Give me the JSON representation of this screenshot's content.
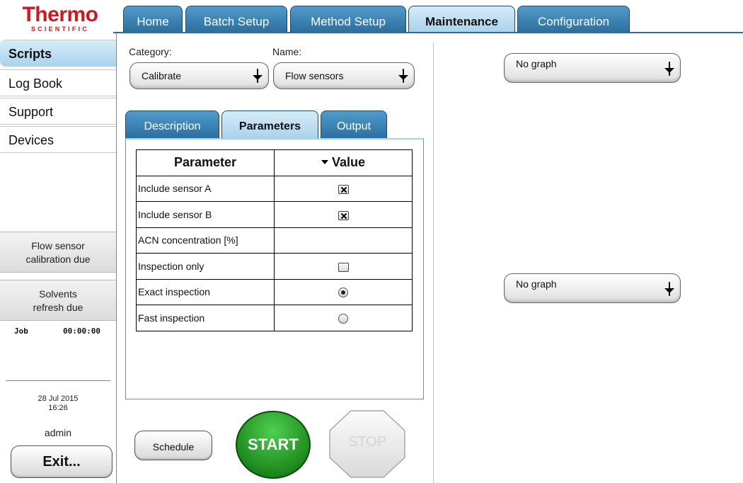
{
  "logo": {
    "main": "Thermo",
    "sub": "SCIENTIFIC"
  },
  "top_tabs": [
    {
      "label": "Home"
    },
    {
      "label": "Batch Setup"
    },
    {
      "label": "Method Setup"
    },
    {
      "label": "Maintenance",
      "active": true
    },
    {
      "label": "Configuration"
    }
  ],
  "sidebar": {
    "items": [
      {
        "label": "Scripts",
        "active": true
      },
      {
        "label": "Log Book"
      },
      {
        "label": "Support"
      },
      {
        "label": "Devices"
      }
    ],
    "status1": {
      "line1": "Flow sensor",
      "line2": "calibration due"
    },
    "status2": {
      "line1": "Solvents",
      "line2": "refresh due"
    },
    "job": {
      "label": "Job",
      "time": "00:00:00"
    },
    "date": "28 Jul 2015",
    "time": "16:26",
    "user": "admin",
    "exit_label": "Exit..."
  },
  "form": {
    "category_label": "Category:",
    "category_value": "Calibrate",
    "name_label": "Name:",
    "name_value": "Flow sensors"
  },
  "sub_tabs": [
    {
      "label": "Description"
    },
    {
      "label": "Parameters",
      "active": true
    },
    {
      "label": "Output"
    }
  ],
  "params_table": {
    "col_parameter": "Parameter",
    "col_value": "Value",
    "rows": [
      {
        "name": "Include sensor A",
        "type": "checkbox",
        "checked": true
      },
      {
        "name": "Include sensor B",
        "type": "checkbox",
        "checked": true
      },
      {
        "name": "ACN concentration [%]",
        "type": "text",
        "value": ""
      },
      {
        "name": "Inspection only",
        "type": "checkbox",
        "checked": false
      },
      {
        "name": "Exact inspection",
        "type": "radio",
        "selected": true
      },
      {
        "name": "Fast inspection",
        "type": "radio",
        "selected": false
      }
    ]
  },
  "actions": {
    "schedule": "Schedule",
    "start": "START",
    "stop": "STOP"
  },
  "graphs": {
    "graph1": "No graph",
    "graph2": "No graph"
  },
  "colors": {
    "tab_blue": "#2c6e9e",
    "start_green": "#1d8a1d",
    "logo_red": "#d0161e"
  }
}
